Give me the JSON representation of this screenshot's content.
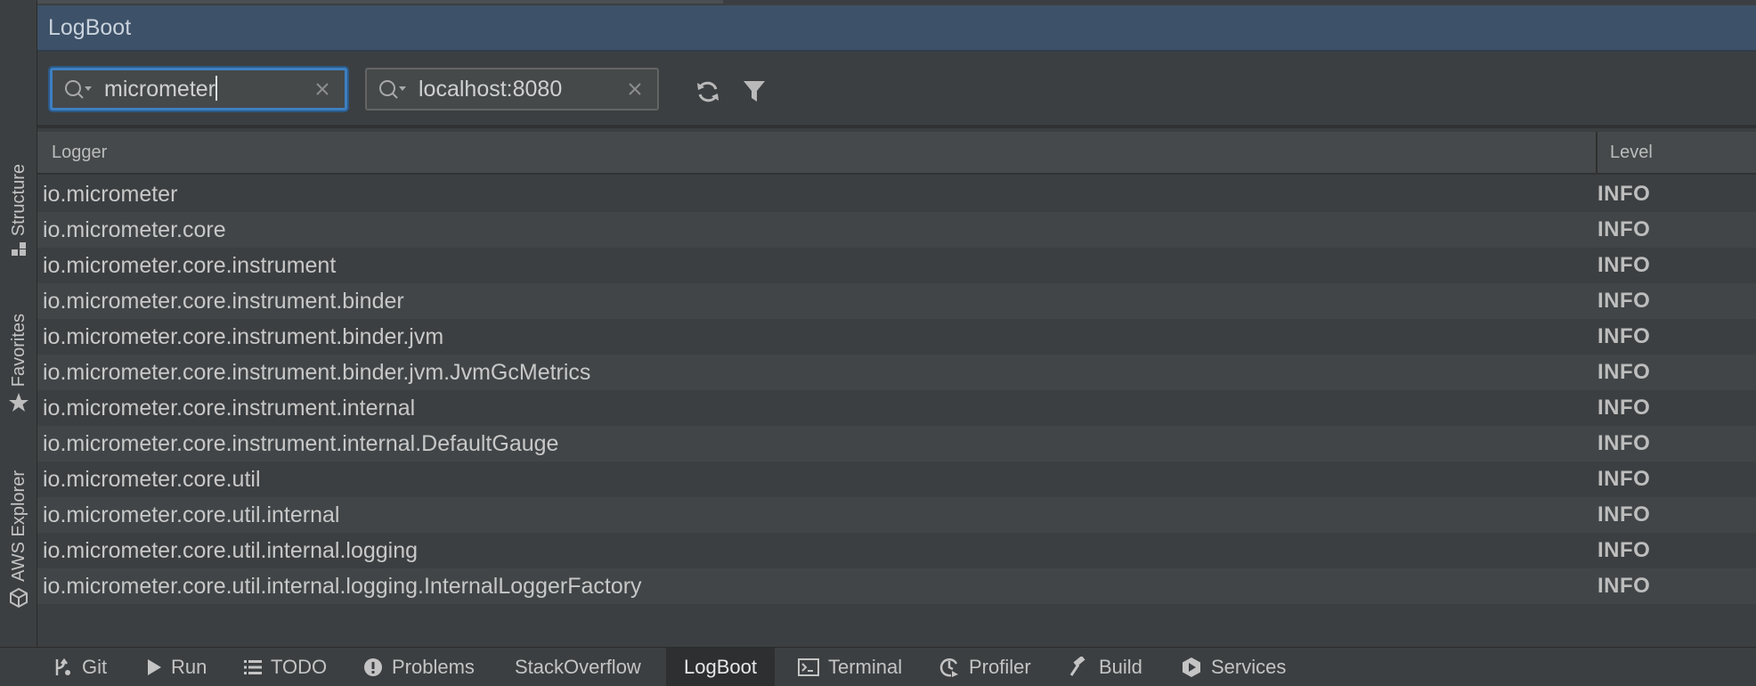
{
  "panel": {
    "title": "LogBoot"
  },
  "toolbar": {
    "logger_filter": {
      "value": "micrometer",
      "icon": "search-history-icon"
    },
    "host_filter": {
      "value": "localhost:8080",
      "icon": "search-history-icon"
    },
    "refresh_icon": "refresh-icon",
    "filter_icon": "filter-icon"
  },
  "table": {
    "columns": {
      "logger": "Logger",
      "level": "Level"
    },
    "rows": [
      {
        "logger": "io.micrometer",
        "level": "INFO"
      },
      {
        "logger": "io.micrometer.core",
        "level": "INFO"
      },
      {
        "logger": "io.micrometer.core.instrument",
        "level": "INFO"
      },
      {
        "logger": "io.micrometer.core.instrument.binder",
        "level": "INFO"
      },
      {
        "logger": "io.micrometer.core.instrument.binder.jvm",
        "level": "INFO"
      },
      {
        "logger": "io.micrometer.core.instrument.binder.jvm.JvmGcMetrics",
        "level": "INFO"
      },
      {
        "logger": "io.micrometer.core.instrument.internal",
        "level": "INFO"
      },
      {
        "logger": "io.micrometer.core.instrument.internal.DefaultGauge",
        "level": "INFO"
      },
      {
        "logger": "io.micrometer.core.util",
        "level": "INFO"
      },
      {
        "logger": "io.micrometer.core.util.internal",
        "level": "INFO"
      },
      {
        "logger": "io.micrometer.core.util.internal.logging",
        "level": "INFO"
      },
      {
        "logger": "io.micrometer.core.util.internal.logging.InternalLoggerFactory",
        "level": "INFO"
      }
    ]
  },
  "side_tabs": [
    {
      "label": "Structure",
      "icon": "structure-icon"
    },
    {
      "label": "Favorites",
      "icon": "star-icon"
    },
    {
      "label": "AWS Explorer",
      "icon": "cube-icon"
    }
  ],
  "bottom_tabs": [
    {
      "label": "Git",
      "icon": "git-icon"
    },
    {
      "label": "Run",
      "icon": "play-icon"
    },
    {
      "label": "TODO",
      "icon": "list-icon"
    },
    {
      "label": "Problems",
      "icon": "warning-icon"
    },
    {
      "label": "StackOverflow",
      "icon": ""
    },
    {
      "label": "LogBoot",
      "icon": "",
      "active": true
    },
    {
      "label": "Terminal",
      "icon": "terminal-icon"
    },
    {
      "label": "Profiler",
      "icon": "profiler-icon"
    },
    {
      "label": "Build",
      "icon": "hammer-icon"
    },
    {
      "label": "Services",
      "icon": "services-icon"
    }
  ],
  "colors": {
    "title_bar": "#3d5168",
    "focus_border": "#3d7fc1",
    "background": "#3c3f41",
    "row_alt": "#414547"
  }
}
